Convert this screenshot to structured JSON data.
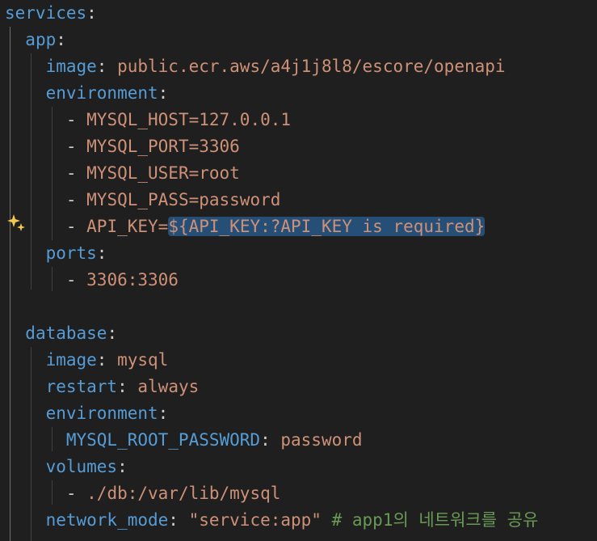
{
  "editor": {
    "language": "yaml",
    "colors": {
      "background": "#1f1f1f",
      "key": "#569cd6",
      "string": "#ce9178",
      "punctuation": "#cccccc",
      "comment": "#6a9955",
      "selection": "#264f78",
      "sparkle": "#f2c84b"
    },
    "gutter_icon": "sparkle-icon",
    "lines": {
      "l1": {
        "key": "services",
        "colon": ":"
      },
      "l2": {
        "key": "app",
        "colon": ":"
      },
      "l3": {
        "key": "image",
        "colon": ": ",
        "value": "public.ecr.aws/a4j1j8l8/escore/openapi"
      },
      "l4": {
        "key": "environment",
        "colon": ":"
      },
      "l5": {
        "dash": "- ",
        "value": "MYSQL_HOST=127.0.0.1"
      },
      "l6": {
        "dash": "- ",
        "value": "MYSQL_PORT=3306"
      },
      "l7": {
        "dash": "- ",
        "value": "MYSQL_USER=root"
      },
      "l8": {
        "dash": "- ",
        "value": "MYSQL_PASS=password"
      },
      "l9": {
        "dash": "- ",
        "value": "API_KEY=",
        "selected": "${API_KEY:?API_KEY is required}"
      },
      "l10": {
        "key": "ports",
        "colon": ":"
      },
      "l11": {
        "dash": "- ",
        "value": "3306:3306"
      },
      "l13": {
        "key": "database",
        "colon": ":"
      },
      "l14": {
        "key": "image",
        "colon": ": ",
        "value": "mysql"
      },
      "l15": {
        "key": "restart",
        "colon": ": ",
        "value": "always"
      },
      "l16": {
        "key": "environment",
        "colon": ":"
      },
      "l17": {
        "key": "MYSQL_ROOT_PASSWORD",
        "colon": ": ",
        "value": "password"
      },
      "l18": {
        "key": "volumes",
        "colon": ":"
      },
      "l19": {
        "dash": "- ",
        "value": "./db:/var/lib/mysql"
      },
      "l20": {
        "key": "network_mode",
        "colon": ": ",
        "value": "\"service:app\"",
        "comment": " # app1의 네트워크를 공유"
      }
    }
  }
}
